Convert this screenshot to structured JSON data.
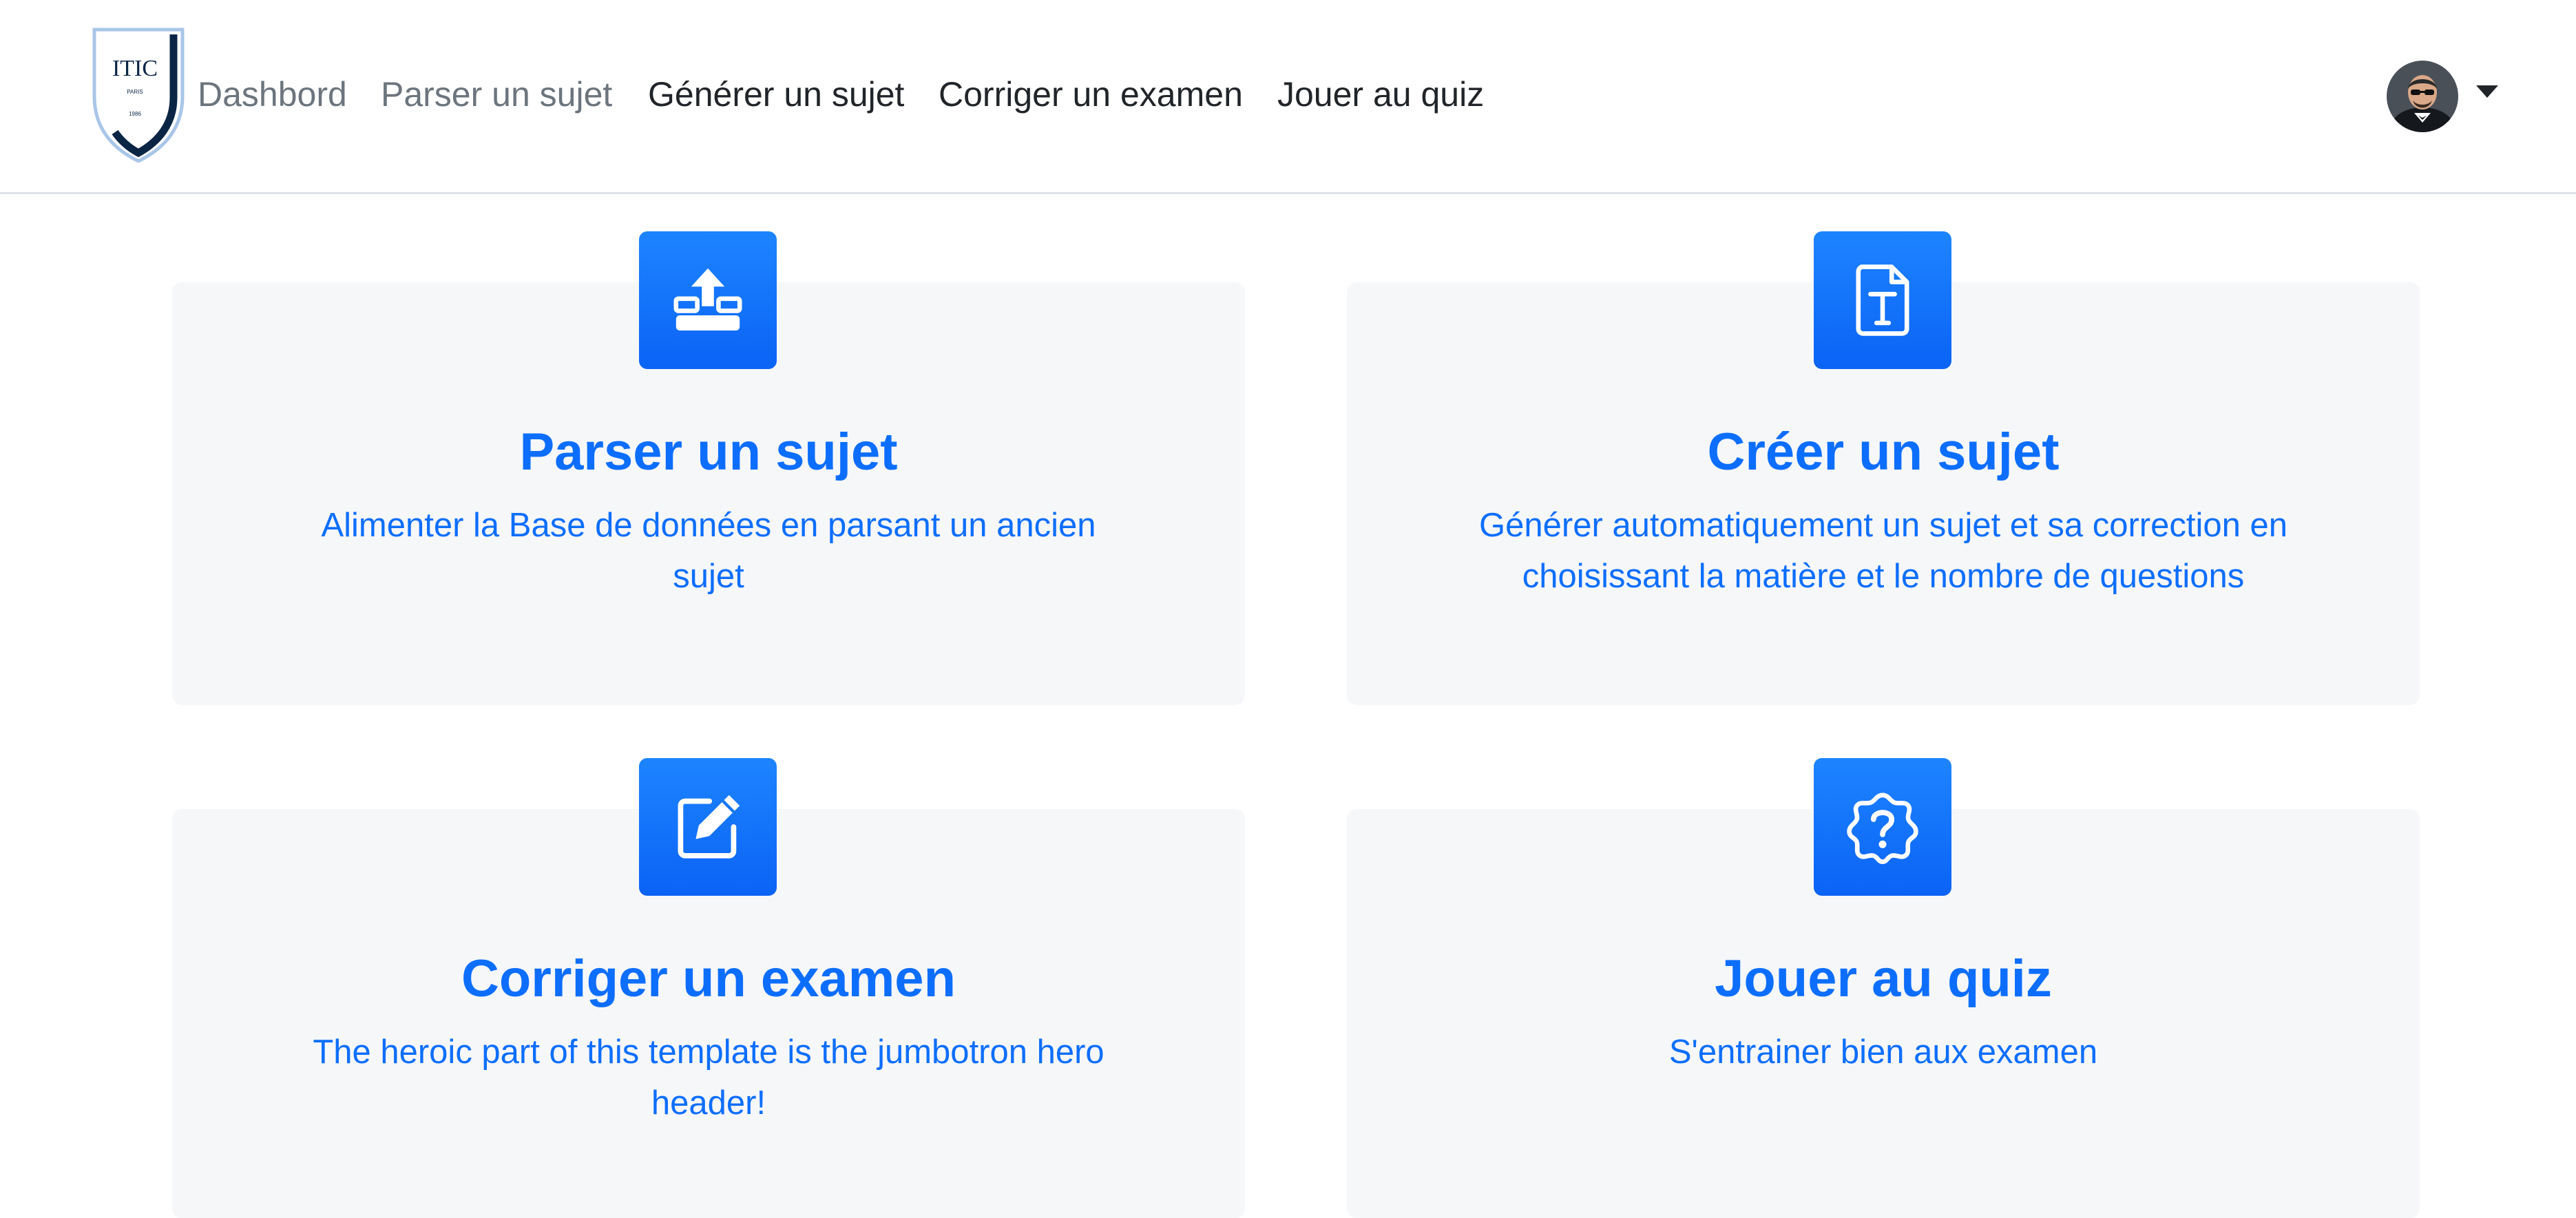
{
  "logo": {
    "text": "ITIC",
    "city": "PARIS",
    "year": "1986"
  },
  "nav": {
    "items": [
      {
        "label": "Dashbord"
      },
      {
        "label": "Parser un sujet"
      },
      {
        "label": "Générer un sujet"
      },
      {
        "label": "Corriger un examen"
      },
      {
        "label": "Jouer au quiz"
      }
    ]
  },
  "cards": [
    {
      "title": "Parser un sujet",
      "text": "Alimenter la Base de données en parsant un ancien sujet",
      "icon": "upload-icon"
    },
    {
      "title": "Créer un sujet",
      "text": "Générer automatiquement un sujet et sa correction en choisissant la matière et le nombre de questions",
      "icon": "file-text-icon"
    },
    {
      "title": "Corriger un examen",
      "text": "The heroic part of this template is the jumbotron hero header!",
      "icon": "edit-icon"
    },
    {
      "title": "Jouer au quiz",
      "text": "S'entrainer bien aux examen",
      "icon": "question-badge-icon"
    }
  ],
  "colors": {
    "accent": "#0d6efd",
    "card_bg": "#f6f7f9",
    "muted_link": "#6c757d",
    "dark_link": "#212529",
    "logo_navy": "#0b2545"
  }
}
